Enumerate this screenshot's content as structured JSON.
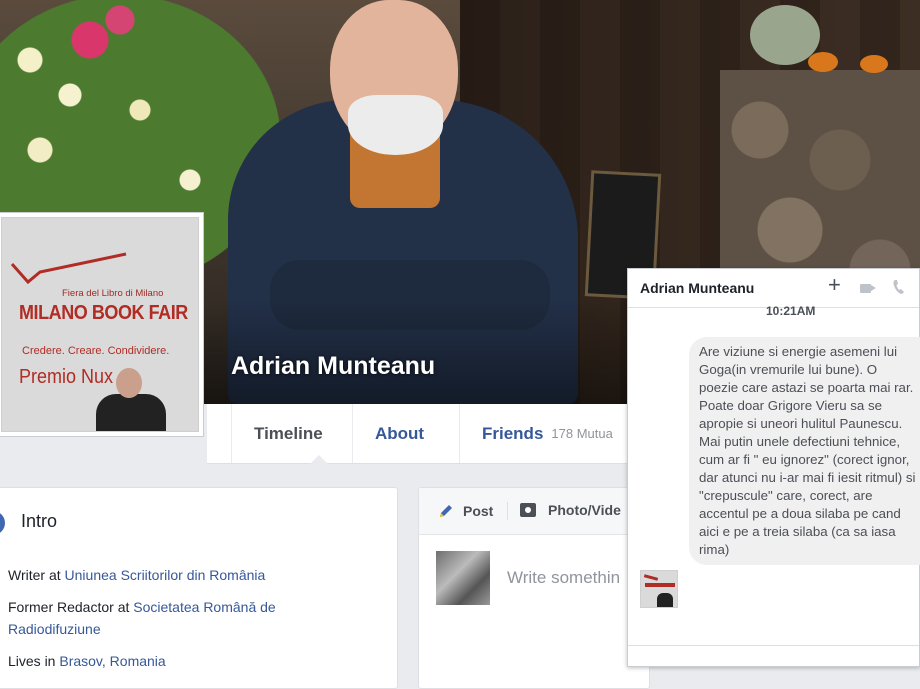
{
  "profile": {
    "name": "Adrian Munteanu",
    "picture_text": {
      "line1": "Fiera del Libro di Milano",
      "line2": "MILANO BOOK FAIR",
      "line3": "Credere. Creare. Condividere.",
      "line4": "Premio Nux"
    }
  },
  "nav": {
    "tabs": [
      {
        "label": "Timeline",
        "active": true
      },
      {
        "label": "About"
      },
      {
        "label": "Friends",
        "count": "178 Mutua"
      }
    ]
  },
  "intro": {
    "title": "Intro",
    "items": [
      {
        "prefix": "Writer at ",
        "link": "Uniunea Scriitorilor din România"
      },
      {
        "prefix": "Former Redactor at ",
        "link": "Societatea Română de Radiodifuziune"
      },
      {
        "prefix": "Lives in ",
        "link": "Brasov, Romania"
      }
    ]
  },
  "composer": {
    "post_label": "Post",
    "photo_label": "Photo/Vide",
    "placeholder": "Write somethin"
  },
  "chat": {
    "contact_name": "Adrian Munteanu",
    "time": "10:21AM",
    "message": "Are viziune si energie asemeni lui Goga(in vremurile lui bune). O poezie care astazi se poarta mai rar. Poate doar Grigore Vieru sa se apropie si uneori hulitul Paunescu. Mai putin unele defectiuni tehnice, cum ar fi \" eu ignorez\" (corect ignor, dar atunci nu i-ar mai fi iesit ritmul) si \"crepuscule\" care, corect, are accentul pe a doua silaba pe cand aici e pe a treia silaba (ca sa iasa rima)",
    "icons": [
      "plus-icon",
      "video-call-icon",
      "phone-icon"
    ]
  },
  "colors": {
    "facebook_blue": "#365899",
    "accent": "#4267b2",
    "background": "#e9ebee",
    "book_fair_red": "#b12c25"
  }
}
